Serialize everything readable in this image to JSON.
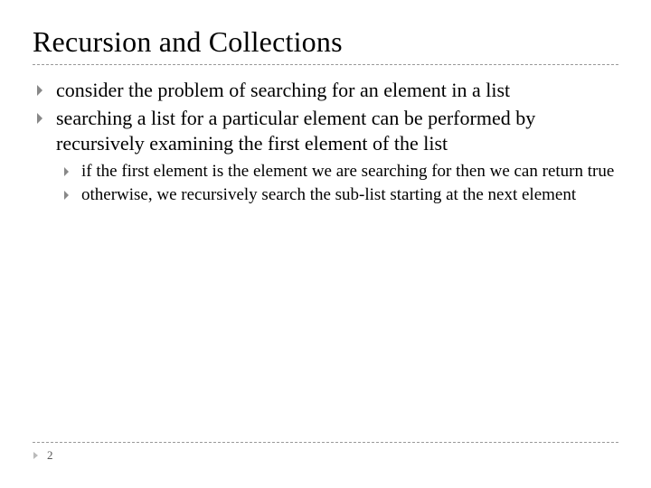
{
  "title": "Recursion and Collections",
  "bullets": [
    "consider the problem of searching for an element in a list",
    "searching a list for a particular element can be performed by recursively examining the first element of the list"
  ],
  "sub_bullets": [
    "if the first element is the element we are searching for then we can return true",
    "otherwise, we recursively search the sub-list starting at the next element"
  ],
  "page_number": "2"
}
